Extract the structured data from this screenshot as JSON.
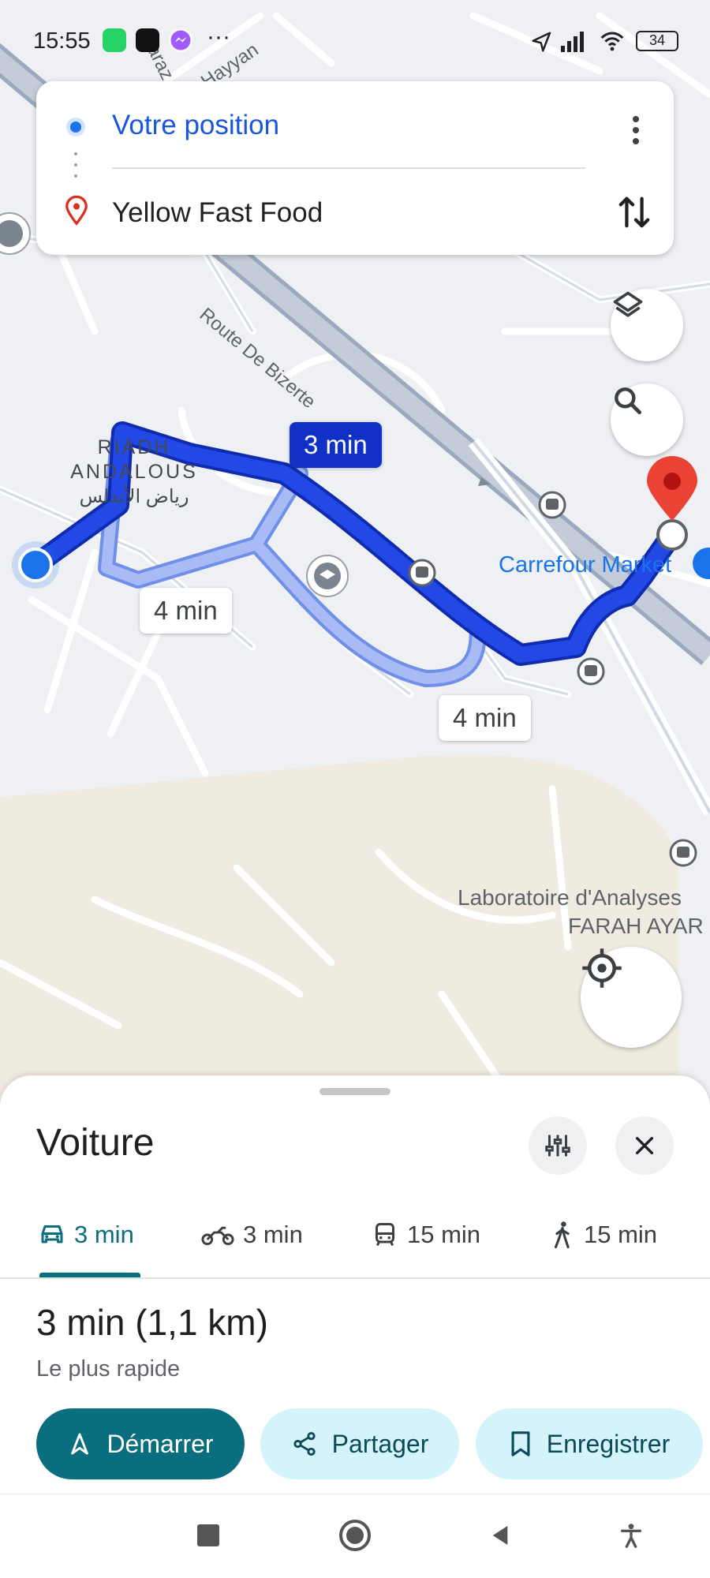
{
  "status_bar": {
    "time": "15:55",
    "more": "···",
    "battery": "34",
    "icons": [
      "whatsapp-icon",
      "tiktok-icon",
      "messenger-icon",
      "location-arrow-icon",
      "signal-icon",
      "wifi-icon",
      "battery-icon"
    ]
  },
  "route_card": {
    "origin": "Votre position",
    "destination": "Yellow Fast Food",
    "menu_icon": "more-vert-icon",
    "swap_icon": "swap-vertical-icon"
  },
  "map": {
    "road_labels": [
      "Route De Bizerte",
      "Hayyan",
      "araz k"
    ],
    "district": {
      "line1": "RIADH",
      "line2": "ANDALOUS",
      "arabic": "رياض الأندلس"
    },
    "pois": [
      "Carrefour Market",
      "Laboratoire d'Analyses",
      "FARAH AYAR"
    ],
    "time_bubbles": {
      "selected": "3 min",
      "alt1": "4 min",
      "alt2": "4 min"
    },
    "buttons": [
      "layers-icon",
      "search-icon",
      "my-location-icon"
    ],
    "colors": {
      "route_main": "#1030c6",
      "route_alt": "#a9bbf4",
      "destination_pin": "#ea4335"
    }
  },
  "sheet": {
    "title": "Voiture",
    "tabs": [
      {
        "icon": "car-icon",
        "label": "3 min"
      },
      {
        "icon": "motorcycle-icon",
        "label": "3 min"
      },
      {
        "icon": "transit-icon",
        "label": "15 min"
      },
      {
        "icon": "walk-icon",
        "label": "15 min"
      }
    ],
    "summary": "3 min (1,1 km)",
    "sub": "Le plus rapide",
    "start_label": "Démarrer",
    "share_label": "Partager",
    "save_label": "Enregistrer",
    "accent": "#0b6e7e"
  },
  "nav": {
    "icons": [
      "recents-square-icon",
      "home-circle-icon",
      "back-triangle-icon",
      "accessibility-icon"
    ]
  }
}
